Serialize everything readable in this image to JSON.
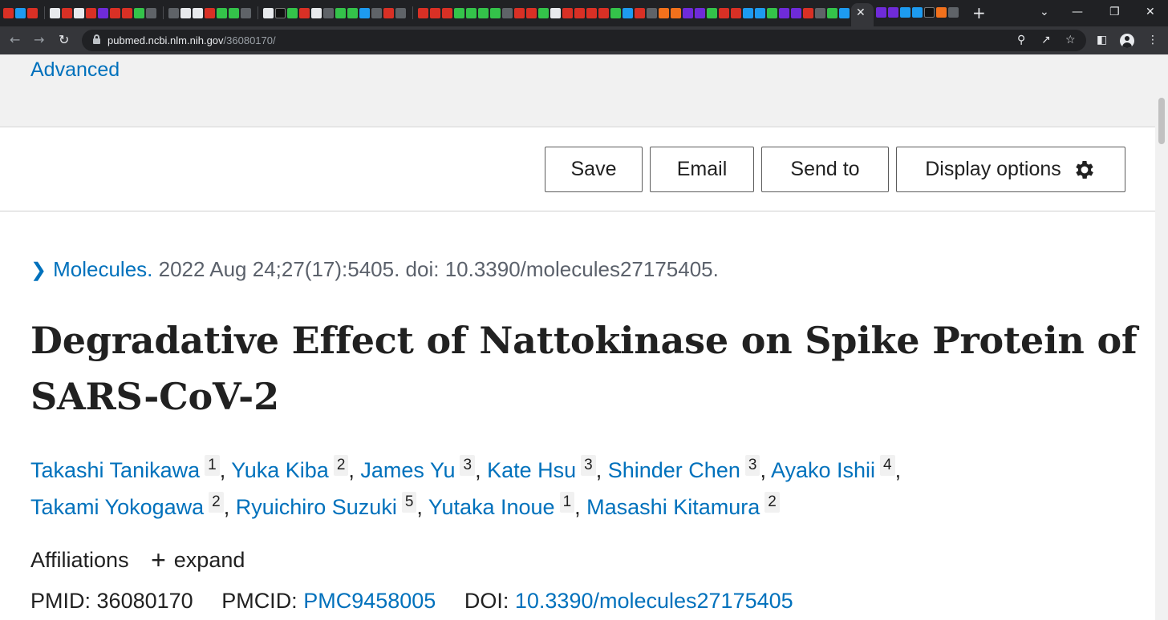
{
  "browser": {
    "url_host": "pubmed.ncbi.nlm.nih.gov",
    "url_path": "/36080170/",
    "close_tab_glyph": "✕",
    "new_tab_glyph": "+"
  },
  "search": {
    "advanced_label": "Advanced"
  },
  "actions": {
    "save_label": "Save",
    "email_label": "Email",
    "send_to_label": "Send to",
    "display_options_label": "Display options"
  },
  "citation": {
    "journal": "Molecules.",
    "details": "2022 Aug 24;27(17):5405. doi: 10.3390/molecules27175405."
  },
  "article": {
    "title": "Degradative Effect of Nattokinase on Spike Protein of SARS-CoV-2"
  },
  "authors": [
    {
      "name": "Takashi Tanikawa",
      "aff": "1"
    },
    {
      "name": "Yuka Kiba",
      "aff": "2"
    },
    {
      "name": "James Yu",
      "aff": "3"
    },
    {
      "name": "Kate Hsu",
      "aff": "3"
    },
    {
      "name": "Shinder Chen",
      "aff": "3"
    },
    {
      "name": "Ayako Ishii",
      "aff": "4"
    },
    {
      "name": "Takami Yokogawa",
      "aff": "2"
    },
    {
      "name": "Ryuichiro Suzuki",
      "aff": "5"
    },
    {
      "name": "Yutaka Inoue",
      "aff": "1"
    },
    {
      "name": "Masashi Kitamura",
      "aff": "2"
    }
  ],
  "affiliations": {
    "label": "Affiliations",
    "expand_label": "expand",
    "plus_glyph": "+"
  },
  "identifiers": {
    "pmid_label": "PMID:",
    "pmid": "36080170",
    "pmcid_label": "PMCID:",
    "pmcid": "PMC9458005",
    "doi_label": "DOI:",
    "doi": "10.3390/molecules27175405"
  },
  "colors": {
    "link": "#0071bc",
    "text": "#212121",
    "muted": "#5b616b",
    "band": "#f1f1f1"
  }
}
